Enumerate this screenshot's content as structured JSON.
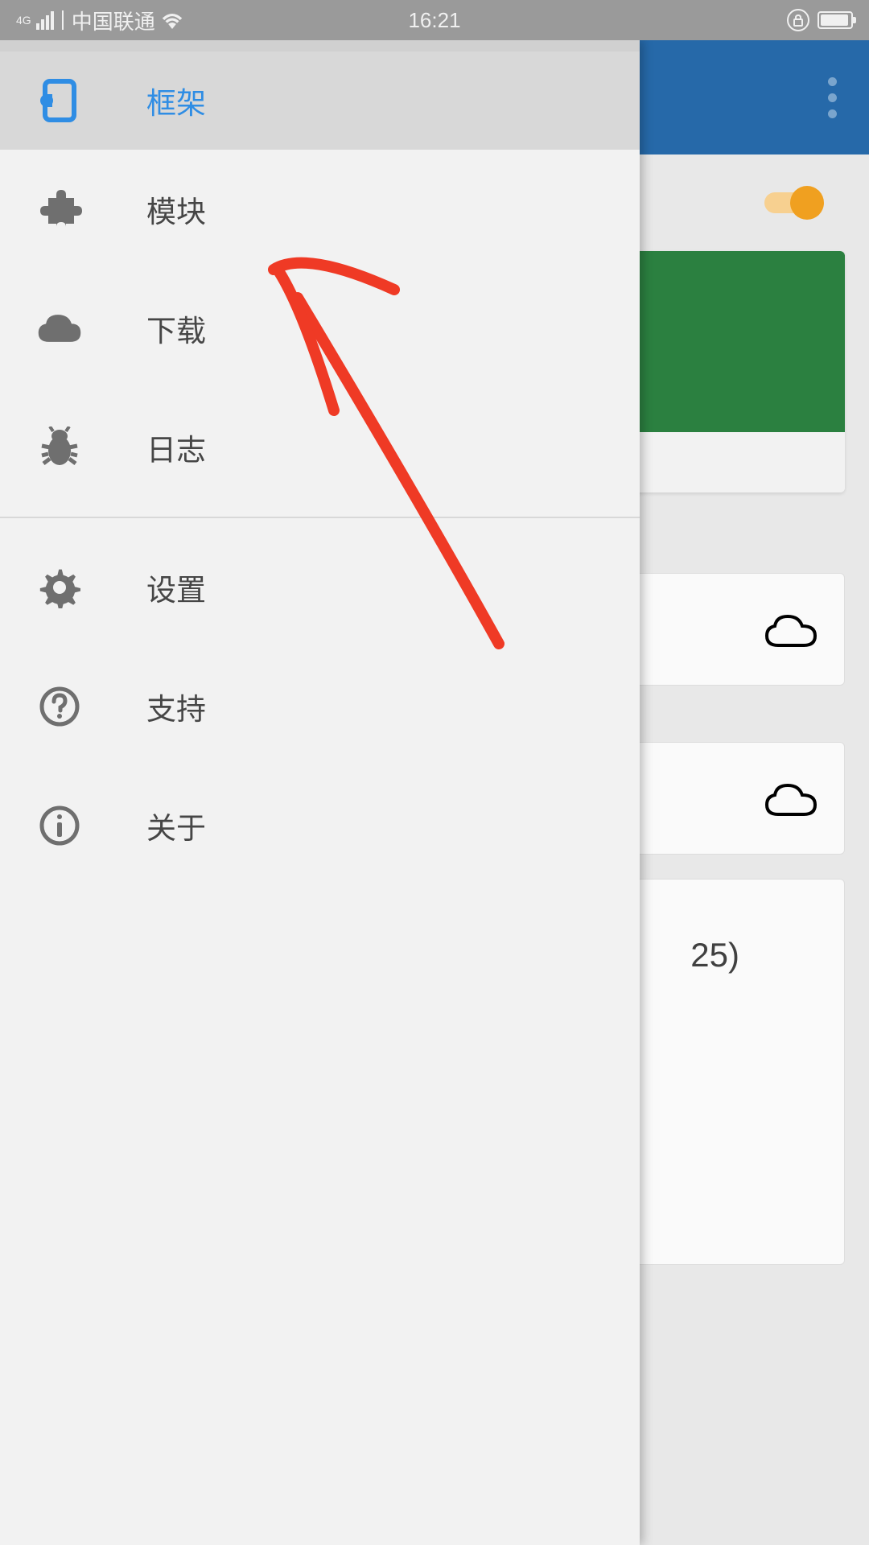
{
  "status": {
    "carrier_label": "中国联通",
    "network_badge": "4G",
    "time": "16:21"
  },
  "drawer": {
    "items": [
      {
        "label": "框架",
        "icon": "framework-icon",
        "active": true
      },
      {
        "label": "模块",
        "icon": "puzzle-icon",
        "active": false
      },
      {
        "label": "下载",
        "icon": "cloud-icon",
        "active": false
      },
      {
        "label": "日志",
        "icon": "bug-icon",
        "active": false
      },
      {
        "label": "设置",
        "icon": "gear-icon",
        "active": false
      },
      {
        "label": "支持",
        "icon": "help-icon",
        "active": false
      },
      {
        "label": "关于",
        "icon": "info-icon",
        "active": false
      }
    ]
  },
  "background": {
    "partial_text": "25)"
  },
  "colors": {
    "accent": "#2f8de4",
    "header": "#2669a9",
    "toggle_on": "#f0a020",
    "success_green": "#2b8040",
    "icon_gray": "#6f6f6f"
  }
}
